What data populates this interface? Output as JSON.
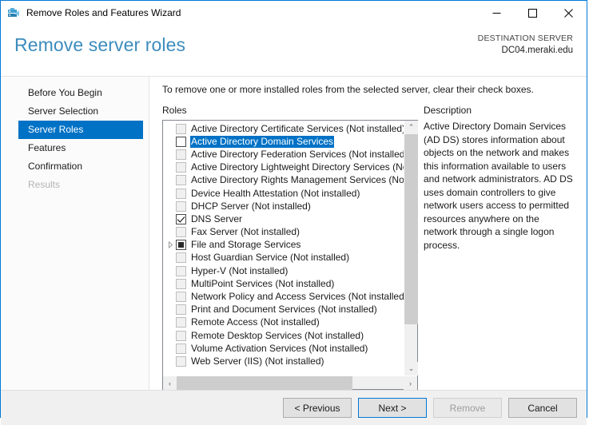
{
  "window": {
    "title": "Remove Roles and Features Wizard",
    "icon": "server-manager-icon",
    "minimize_label": "─",
    "maximize_label": "☐",
    "close_label": "✕",
    "accent_color": "#0078d7"
  },
  "header": {
    "page_title": "Remove server roles",
    "page_title_color": "#3c8cbd",
    "destination_label": "DESTINATION SERVER",
    "destination_server": "DC04.meraki.edu"
  },
  "nav": {
    "items": [
      {
        "label": "Before You Begin",
        "state": "normal"
      },
      {
        "label": "Server Selection",
        "state": "normal"
      },
      {
        "label": "Server Roles",
        "state": "selected"
      },
      {
        "label": "Features",
        "state": "normal"
      },
      {
        "label": "Confirmation",
        "state": "normal"
      },
      {
        "label": "Results",
        "state": "disabled"
      }
    ],
    "selected_color": "#0072c6"
  },
  "main": {
    "instruction": "To remove one or more installed roles from the selected server, clear their check boxes.",
    "roles_label": "Roles",
    "description_label": "Description",
    "description_text": "Active Directory Domain Services (AD DS) stores information about objects on the network and makes this information available to users and network administrators. AD DS uses domain controllers to give network users access to permitted resources anywhere on the network through a single logon process."
  },
  "roles": [
    {
      "label": "Active Directory Certificate Services (Not installed)",
      "checkbox": "unchecked-disabled",
      "selected": false,
      "expandable": false
    },
    {
      "label": "Active Directory Domain Services",
      "checkbox": "unchecked-enabled",
      "selected": true,
      "expandable": false
    },
    {
      "label": "Active Directory Federation Services (Not installed)",
      "checkbox": "unchecked-disabled",
      "selected": false,
      "expandable": false
    },
    {
      "label": "Active Directory Lightweight Directory Services (Not installed)",
      "checkbox": "unchecked-disabled",
      "selected": false,
      "expandable": false
    },
    {
      "label": "Active Directory Rights Management Services (Not installed)",
      "checkbox": "unchecked-disabled",
      "selected": false,
      "expandable": false
    },
    {
      "label": "Device Health Attestation (Not installed)",
      "checkbox": "unchecked-disabled",
      "selected": false,
      "expandable": false
    },
    {
      "label": "DHCP Server (Not installed)",
      "checkbox": "unchecked-disabled",
      "selected": false,
      "expandable": false
    },
    {
      "label": "DNS Server",
      "checkbox": "checked",
      "selected": false,
      "expandable": false
    },
    {
      "label": "Fax Server (Not installed)",
      "checkbox": "unchecked-disabled",
      "selected": false,
      "expandable": false
    },
    {
      "label": "File and Storage Services",
      "checkbox": "partial",
      "selected": false,
      "expandable": true
    },
    {
      "label": "Host Guardian Service (Not installed)",
      "checkbox": "unchecked-disabled",
      "selected": false,
      "expandable": false
    },
    {
      "label": "Hyper-V (Not installed)",
      "checkbox": "unchecked-disabled",
      "selected": false,
      "expandable": false
    },
    {
      "label": "MultiPoint Services (Not installed)",
      "checkbox": "unchecked-disabled",
      "selected": false,
      "expandable": false
    },
    {
      "label": "Network Policy and Access Services (Not installed)",
      "checkbox": "unchecked-disabled",
      "selected": false,
      "expandable": false
    },
    {
      "label": "Print and Document Services (Not installed)",
      "checkbox": "unchecked-disabled",
      "selected": false,
      "expandable": false
    },
    {
      "label": "Remote Access (Not installed)",
      "checkbox": "unchecked-disabled",
      "selected": false,
      "expandable": false
    },
    {
      "label": "Remote Desktop Services (Not installed)",
      "checkbox": "unchecked-disabled",
      "selected": false,
      "expandable": false
    },
    {
      "label": "Volume Activation Services (Not installed)",
      "checkbox": "unchecked-disabled",
      "selected": false,
      "expandable": false
    },
    {
      "label": "Web Server (IIS) (Not installed)",
      "checkbox": "unchecked-disabled",
      "selected": false,
      "expandable": false
    }
  ],
  "scrollbars": {
    "vertical_up": "⌃",
    "vertical_down": "⌄",
    "horizontal_left": "‹",
    "horizontal_right": "›"
  },
  "footer": {
    "buttons": [
      {
        "label": "< Previous",
        "state": "normal"
      },
      {
        "label": "Next >",
        "state": "default"
      },
      {
        "label": "Remove",
        "state": "disabled"
      },
      {
        "label": "Cancel",
        "state": "normal"
      }
    ]
  }
}
